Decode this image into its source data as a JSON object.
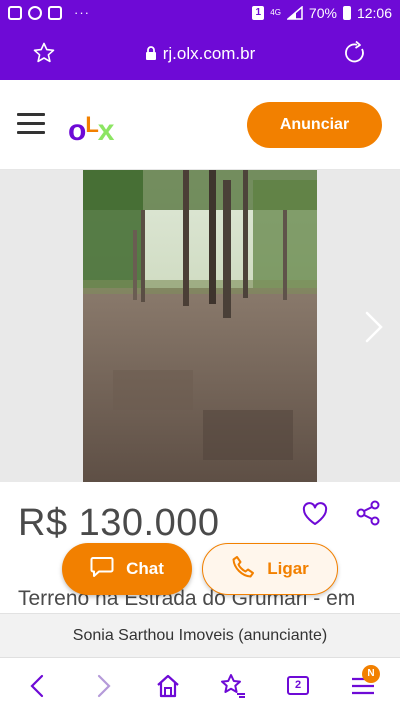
{
  "status_bar": {
    "sim_label": "1",
    "network": "4G",
    "battery": "70%",
    "time": "12:06",
    "overflow_dots": "···"
  },
  "address_bar": {
    "url": "rj.olx.com.br"
  },
  "header": {
    "logo": {
      "o": "o",
      "l": "L",
      "x": "x"
    },
    "cta_label": "Anunciar"
  },
  "listing": {
    "price": "R$ 130.000",
    "title": "Terreno na Estrada do Grumari - em",
    "chat_label": "Chat",
    "call_label": "Ligar",
    "advertiser_name": "Sonia Sarthou Imoveis",
    "advertiser_role": "(anunciante)"
  },
  "browser_nav": {
    "tab_count": "2",
    "notification_badge": "N"
  },
  "colors": {
    "purple": "#6e0ad6",
    "orange": "#f28000",
    "green": "#8ce563"
  },
  "icons": [
    "star-icon",
    "lock-icon",
    "reload-icon",
    "menu-icon",
    "chevron-right-icon",
    "heart-icon",
    "share-icon",
    "chat-bubble-icon",
    "phone-icon",
    "back-icon",
    "forward-icon",
    "home-icon",
    "bookmarks-icon",
    "tabs-icon",
    "menu-icon"
  ]
}
